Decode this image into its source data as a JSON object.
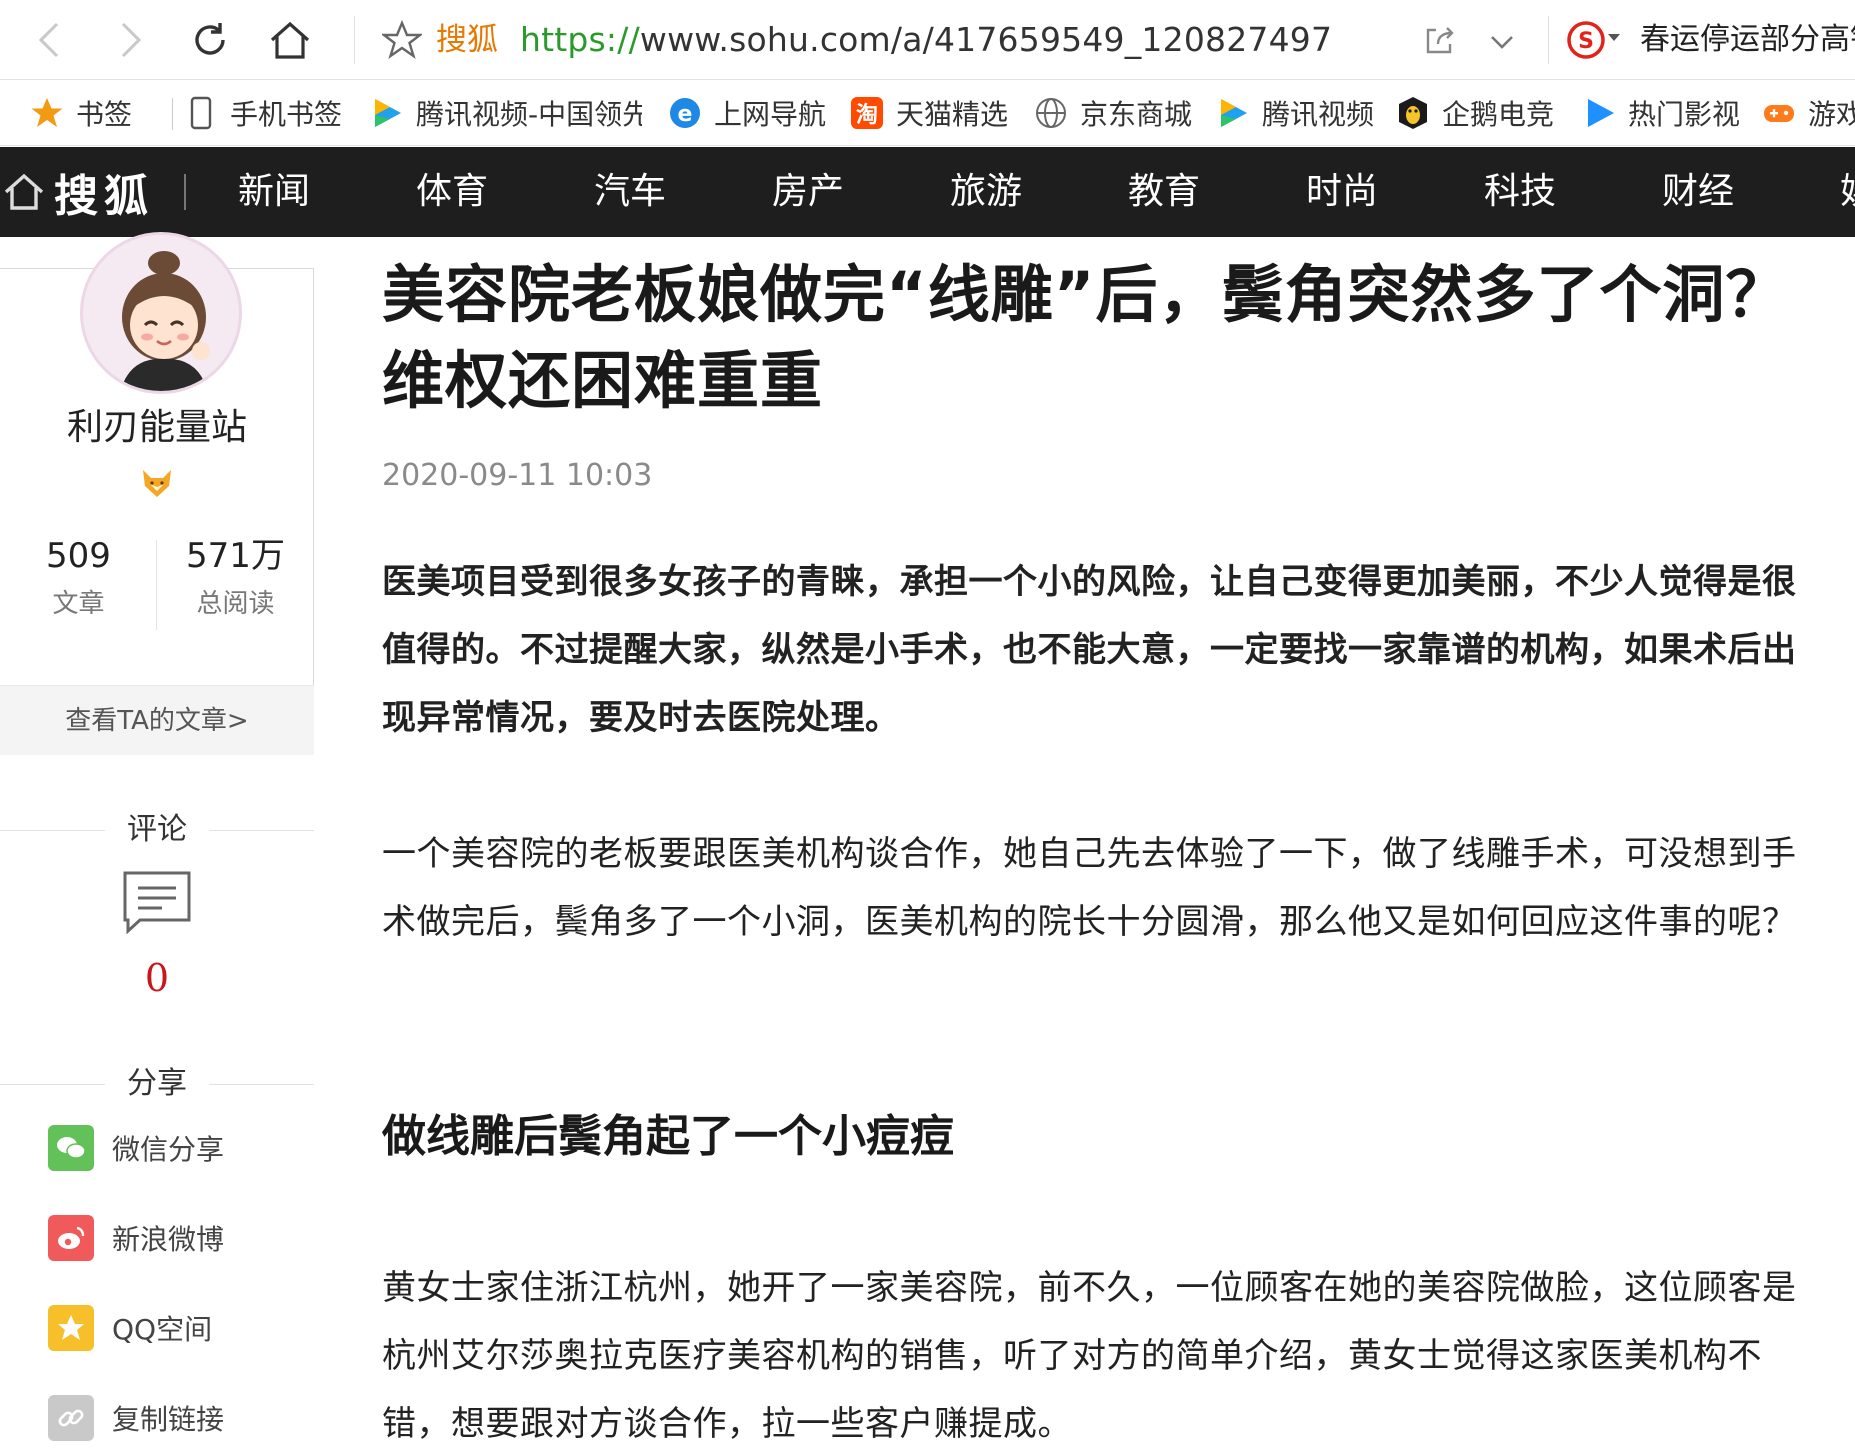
{
  "browser": {
    "site_tag": "搜狐",
    "url_proto": "https://",
    "url_rest": "www.sohu.com/a/417659549_120827497",
    "search_hint": "春运停运部分高铁"
  },
  "bookmarks": [
    {
      "label": "书签",
      "icon": "star-icon"
    },
    {
      "label": "手机书签",
      "icon": "phone-icon"
    },
    {
      "label": "腾讯视频-中国领先",
      "icon": "tencent-video-icon"
    },
    {
      "label": "上网导航",
      "icon": "ie-icon"
    },
    {
      "label": "天猫精选",
      "icon": "tmall-icon"
    },
    {
      "label": "京东商城",
      "icon": "globe-icon"
    },
    {
      "label": "腾讯视频",
      "icon": "tencent-video-icon"
    },
    {
      "label": "企鹅电竞",
      "icon": "penguin-esports-icon"
    },
    {
      "label": "热门影视",
      "icon": "video-play-icon"
    },
    {
      "label": "游戏",
      "icon": "gamepad-icon"
    }
  ],
  "sohu_nav": {
    "brand": "搜狐",
    "items": [
      "新闻",
      "体育",
      "汽车",
      "房产",
      "旅游",
      "教育",
      "时尚",
      "科技",
      "财经",
      "娱"
    ]
  },
  "author": {
    "name": "利刃能量站",
    "articles_count": "509",
    "articles_label": "文章",
    "reads_count": "571万",
    "reads_label": "总阅读",
    "view_articles": "查看TA的文章>"
  },
  "comment": {
    "title": "评论",
    "count": "0"
  },
  "share": {
    "title": "分享",
    "items": [
      {
        "label": "微信分享",
        "color": "#62c158"
      },
      {
        "label": "新浪微博",
        "color": "#f05a5a"
      },
      {
        "label": "QQ空间",
        "color": "#f7c02b"
      },
      {
        "label": "复制链接",
        "color": "#c9c9c9"
      }
    ]
  },
  "article": {
    "title": "美容院老板娘做完“线雕”后，鬓角突然多了个洞？维权还困难重重",
    "time": "2020-09-11 10:03",
    "lead": "医美项目受到很多女孩子的青睐，承担一个小的风险，让自己变得更加美丽，不少人觉得是很值得的。不过提醒大家，纵然是小手术，也不能大意，一定要找一家靠谱的机构，如果术后出现异常情况，要及时去医院处理。",
    "para1": "一个美容院的老板要跟医美机构谈合作，她自己先去体验了一下，做了线雕手术，可没想到手术做完后，鬓角多了一个小洞，医美机构的院长十分圆滑，那么他又是如何回应这件事的呢？",
    "subhead": "做线雕后鬓角起了一个小痘痘",
    "para2": "黄女士家住浙江杭州，她开了一家美容院，前不久，一位顾客在她的美容院做脸，这位顾客是杭州艾尔莎奥拉克医疗美容机构的销售，听了对方的简单介绍，黄女士觉得这家医美机构不错，想要跟对方谈合作，拉一些客户赚提成。"
  }
}
